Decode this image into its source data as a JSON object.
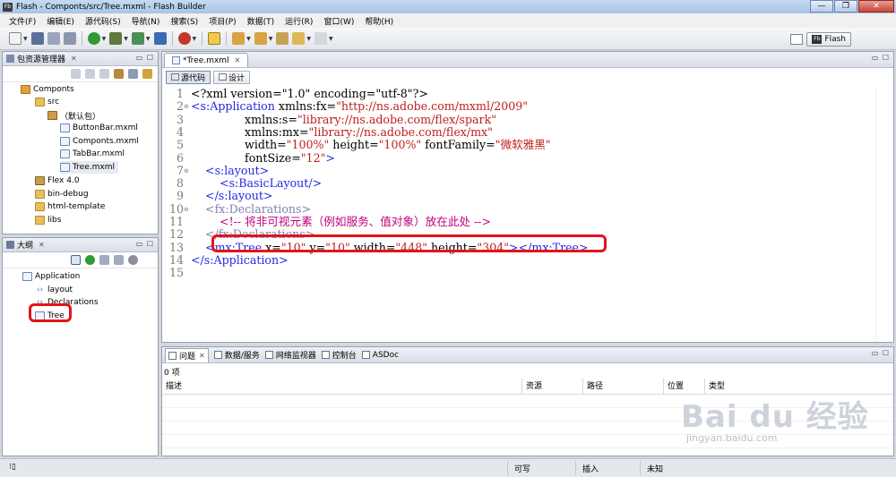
{
  "window": {
    "app_icon": "Fb",
    "title": "Flash - Componts/src/Tree.mxml - Flash Builder",
    "controls": [
      "—",
      "❐",
      "✕"
    ]
  },
  "menu": [
    "文件(F)",
    "编辑(E)",
    "源代码(S)",
    "导航(N)",
    "搜索(S)",
    "项目(P)",
    "数据(T)",
    "运行(R)",
    "窗口(W)",
    "帮助(H)"
  ],
  "perspective": {
    "icon": "Fb",
    "label": "Flash"
  },
  "package_explorer": {
    "tab_label": "包资源管理器",
    "tree": [
      {
        "label": "Componts",
        "icon": "project-icon"
      },
      {
        "label": "src",
        "icon": "source-folder-icon"
      },
      {
        "label": "（默认包）",
        "icon": "package-icon"
      },
      {
        "label": "ButtonBar.mxml",
        "icon": "mxml-file-icon"
      },
      {
        "label": "Componts.mxml",
        "icon": "mxml-file-icon"
      },
      {
        "label": "TabBar.mxml",
        "icon": "mxml-file-icon"
      },
      {
        "label": "Tree.mxml",
        "icon": "mxml-file-icon"
      },
      {
        "label": "Flex 4.0",
        "icon": "library-icon"
      },
      {
        "label": "bin-debug",
        "icon": "folder-icon"
      },
      {
        "label": "html-template",
        "icon": "folder-icon"
      },
      {
        "label": "libs",
        "icon": "folder-icon"
      }
    ]
  },
  "outline": {
    "tab_label": "大纲",
    "tree": [
      {
        "label": "Application",
        "icon": "application-icon"
      },
      {
        "label": "layout",
        "icon": "tag-icon"
      },
      {
        "label": "Declarations",
        "icon": "tag-icon"
      },
      {
        "label": "Tree",
        "icon": "tree-component-icon"
      }
    ]
  },
  "editor": {
    "tab_label": "*Tree.mxml",
    "modes": [
      "源代码",
      "设计"
    ],
    "lines": [
      {
        "n": "1",
        "fold": "",
        "parts": [
          {
            "c": "c-attr",
            "t": "<?xml version=\"1.0\" encoding=\"utf-8\"?>"
          }
        ]
      },
      {
        "n": "2",
        "fold": "⊖",
        "parts": [
          {
            "c": "c-tag",
            "t": "<s:Application"
          },
          {
            "c": "c-attr",
            "t": " xmlns:fx="
          },
          {
            "c": "c-val",
            "t": "\"http://ns.adobe.com/mxml/2009\""
          }
        ]
      },
      {
        "n": "3",
        "fold": "",
        "parts": [
          {
            "c": "c-attr",
            "t": "               xmlns:s="
          },
          {
            "c": "c-val",
            "t": "\"library://ns.adobe.com/flex/spark\""
          }
        ]
      },
      {
        "n": "4",
        "fold": "",
        "parts": [
          {
            "c": "c-attr",
            "t": "               xmlns:mx="
          },
          {
            "c": "c-val",
            "t": "\"library://ns.adobe.com/flex/mx\""
          }
        ]
      },
      {
        "n": "5",
        "fold": "",
        "parts": [
          {
            "c": "c-attr",
            "t": "               width="
          },
          {
            "c": "c-val",
            "t": "\"100%\""
          },
          {
            "c": "c-attr",
            "t": " height="
          },
          {
            "c": "c-val",
            "t": "\"100%\""
          },
          {
            "c": "c-attr",
            "t": " fontFamily="
          },
          {
            "c": "c-val",
            "t": "\"微软雅黑\""
          }
        ]
      },
      {
        "n": "6",
        "fold": "",
        "parts": [
          {
            "c": "c-attr",
            "t": "               fontSize="
          },
          {
            "c": "c-val",
            "t": "\"12\""
          },
          {
            "c": "c-tag",
            "t": ">"
          }
        ]
      },
      {
        "n": "7",
        "fold": "⊖",
        "parts": [
          {
            "c": "c-tag",
            "t": "    <s:layout>"
          }
        ]
      },
      {
        "n": "8",
        "fold": "",
        "parts": [
          {
            "c": "c-tag",
            "t": "        <s:BasicLayout/>"
          }
        ]
      },
      {
        "n": "9",
        "fold": "",
        "parts": [
          {
            "c": "c-tag",
            "t": "    </s:layout>"
          }
        ]
      },
      {
        "n": "10",
        "fold": "⊖",
        "parts": [
          {
            "c": "c-tag2",
            "t": "    <fx:Declarations>"
          }
        ]
      },
      {
        "n": "11",
        "fold": "",
        "parts": [
          {
            "c": "c-com",
            "t": "        <!-- 将非可视元素（例如服务、值对象）放在此处 -->"
          }
        ]
      },
      {
        "n": "12",
        "fold": "",
        "parts": [
          {
            "c": "c-tag2",
            "t": "    </fx:Declarations>"
          }
        ]
      },
      {
        "n": "13",
        "fold": "",
        "parts": [
          {
            "c": "c-tag",
            "t": "    <mx:Tree"
          },
          {
            "c": "c-attr",
            "t": " x="
          },
          {
            "c": "c-val",
            "t": "\"10\""
          },
          {
            "c": "c-attr",
            "t": " y="
          },
          {
            "c": "c-val",
            "t": "\"10\""
          },
          {
            "c": "c-attr",
            "t": " width="
          },
          {
            "c": "c-val",
            "t": "\"448\""
          },
          {
            "c": "c-attr",
            "t": " height="
          },
          {
            "c": "c-val",
            "t": "\"304\""
          },
          {
            "c": "c-tag",
            "t": "></mx:Tree>"
          }
        ]
      },
      {
        "n": "14",
        "fold": "",
        "parts": [
          {
            "c": "c-tag",
            "t": "</s:Application>"
          }
        ]
      },
      {
        "n": "15",
        "fold": "",
        "parts": []
      }
    ]
  },
  "problems": {
    "tabs": [
      "问题",
      "数据/服务",
      "网络监视器",
      "控制台",
      "ASDoc"
    ],
    "count_label": "0 项",
    "columns": [
      "描述",
      "资源",
      "路径",
      "位置",
      "类型"
    ]
  },
  "status": {
    "writable": "可写",
    "insert_mode": "插入",
    "unknown": "未知"
  },
  "watermark": {
    "logo": "Bai du 经验",
    "url": "jingyan.baidu.com"
  }
}
